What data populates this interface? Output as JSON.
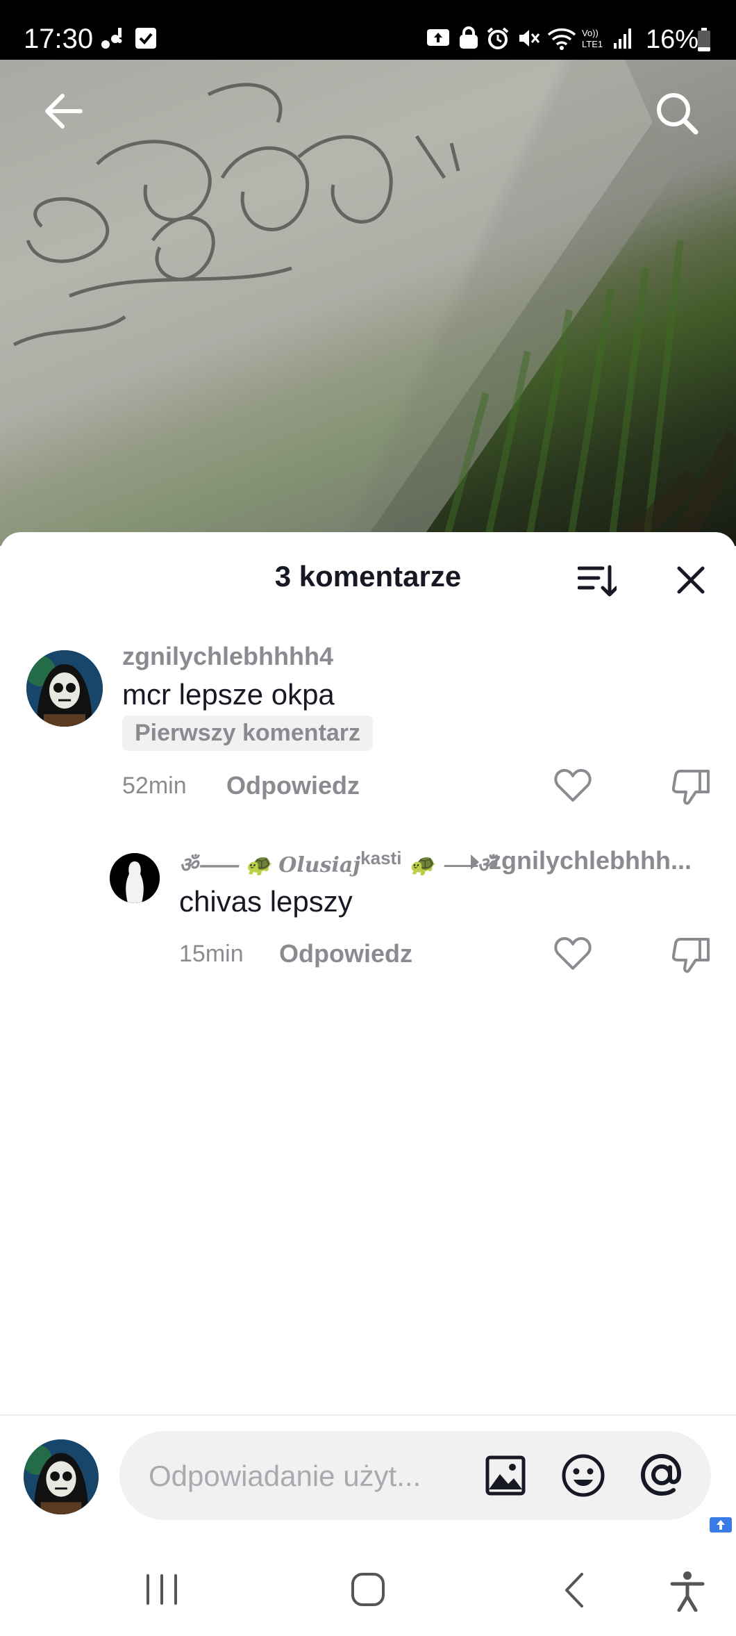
{
  "status_bar": {
    "time": "17:30",
    "battery": "16%",
    "icons": [
      "notification-icon",
      "checkbox-icon",
      "upload-icon",
      "lock-icon",
      "alarm-icon",
      "mute-icon",
      "wifi-icon",
      "volte-icon",
      "signal-icon",
      "battery-icon"
    ]
  },
  "header": {
    "back_icon": "back-arrow-icon",
    "search_icon": "search-icon"
  },
  "comments_sheet": {
    "title": "3 komentarze",
    "sort_icon": "sort-icon",
    "close_icon": "close-icon",
    "comments": [
      {
        "username": "zgnilychlebhhhh4",
        "text": "mcr lepsze okpa",
        "badge": "Pierwszy komentarz",
        "time": "52min",
        "reply_label": "Odpowiedz"
      }
    ],
    "replies": [
      {
        "username": "⸺⸺🐢𝓞𝓵𝓾𝓼𝓲𝓪𝓳 kasti 🐢⸺",
        "username_display": "Olusiaj",
        "username_super": "kasti",
        "reply_to": "zgnilychlebhhh...",
        "text": "chivas lepszy",
        "time": "15min",
        "reply_label": "Odpowiedz"
      }
    ]
  },
  "composer": {
    "placeholder": "Odpowiadanie użyt...",
    "icons": [
      "image-icon",
      "emoji-icon",
      "mention-icon"
    ]
  },
  "nav_bar": {
    "icons": [
      "recent-apps-icon",
      "home-icon",
      "back-icon",
      "accessibility-icon"
    ]
  },
  "colors": {
    "text_primary": "#161823",
    "text_secondary": "#8a8b91",
    "badge_bg": "#f1f1f2"
  }
}
